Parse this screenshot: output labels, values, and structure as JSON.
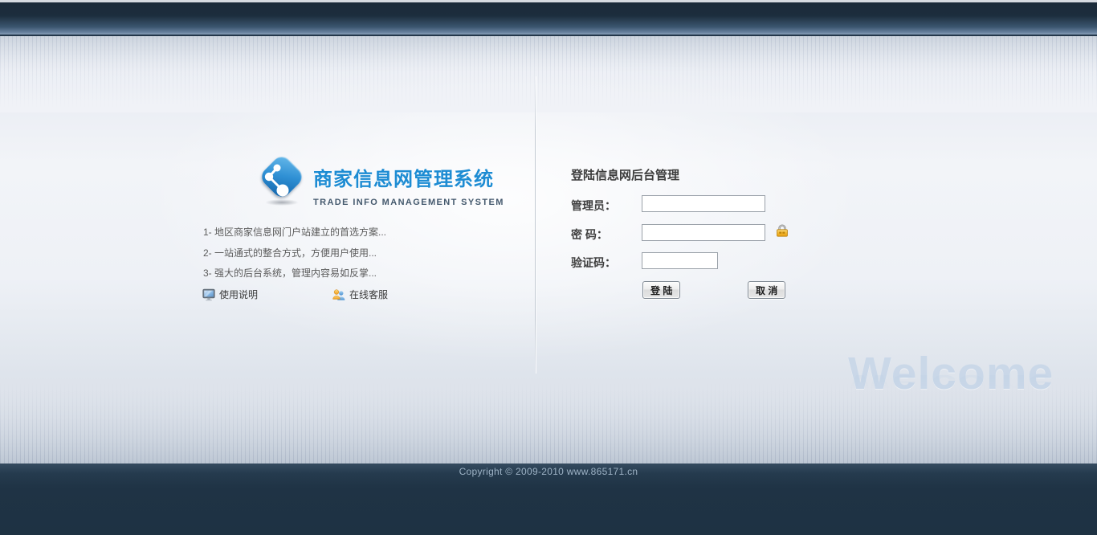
{
  "branding": {
    "title": "商家信息网管理系统",
    "subtitle": "TRADE INFO MANAGEMENT SYSTEM",
    "features": [
      "1- 地区商家信息网门户站建立的首选方案...",
      "2- 一站通式的整合方式，方便用户使用...",
      "3- 强大的后台系统，管理内容易如反掌..."
    ],
    "links": [
      {
        "label": "使用说明",
        "icon": "monitor-icon"
      },
      {
        "label": "在线客服",
        "icon": "people-icon"
      }
    ]
  },
  "login": {
    "heading": "登陆信息网后台管理",
    "admin_label": "管理员：",
    "password_label": "密 码：",
    "captcha_label": "验证码：",
    "admin_value": "",
    "password_value": "",
    "captcha_value": "",
    "login_button": "登 陆",
    "cancel_button": "取 消",
    "lock_icon": "lock-icon"
  },
  "watermark": "Welcome",
  "footer": {
    "copyright": "Copyright © 2009-2010 www.865171.cn"
  },
  "colors": {
    "accent_blue": "#1d8cd3",
    "header_navy": "#1b2b3a",
    "footer_navy": "#1f3345",
    "lock_gold": "#eca817"
  }
}
